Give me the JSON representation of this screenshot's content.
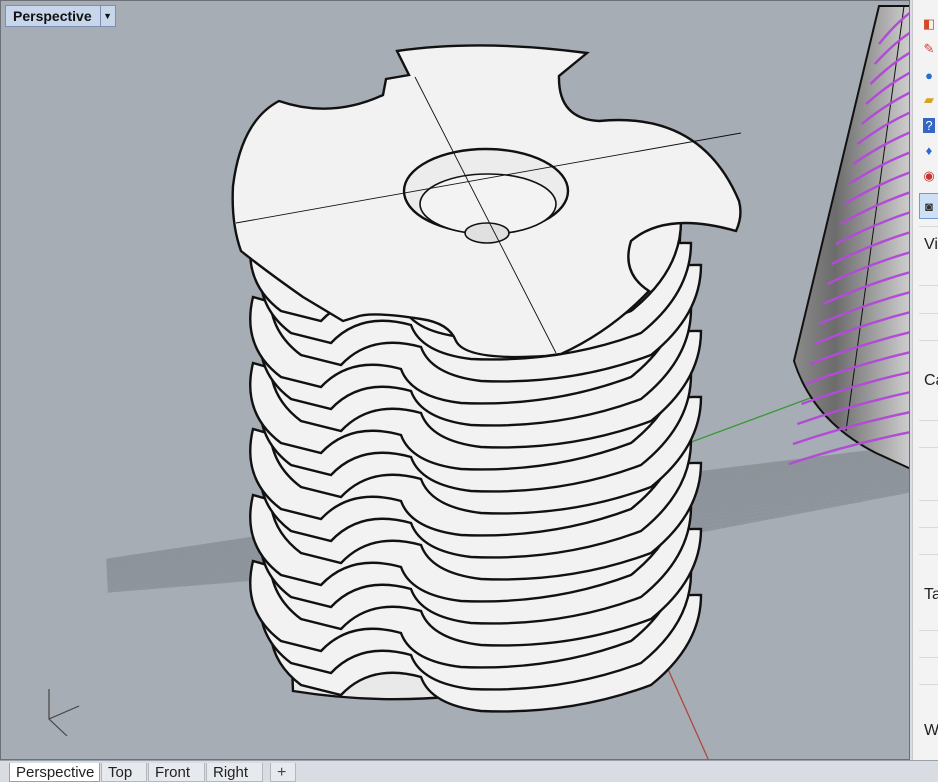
{
  "viewport": {
    "title": "Perspective",
    "background": "#a7adb4"
  },
  "axes_widget": {
    "z": "z",
    "y": "y",
    "x": "x"
  },
  "right_panel": {
    "icons": [
      "display-mode-icon",
      "brush-icon",
      "material-sphere-icon",
      "folder-icon",
      "help-icon",
      "notification-bell-icon",
      "color-wheel-icon",
      "camera-icon"
    ],
    "labels": [
      "Vi",
      "Ca",
      "Ta",
      "W"
    ]
  },
  "tabs": {
    "items": [
      "Perspective",
      "Top",
      "Front",
      "Right"
    ],
    "active": "Perspective",
    "add": "+"
  },
  "colors": {
    "grid": "#8e949b",
    "x_axis": "#b0473f",
    "y_axis": "#3c9a3c",
    "cylinder_curves": "#b24bd6",
    "object_fill": "#f2f2f2",
    "outline": "#111111"
  }
}
